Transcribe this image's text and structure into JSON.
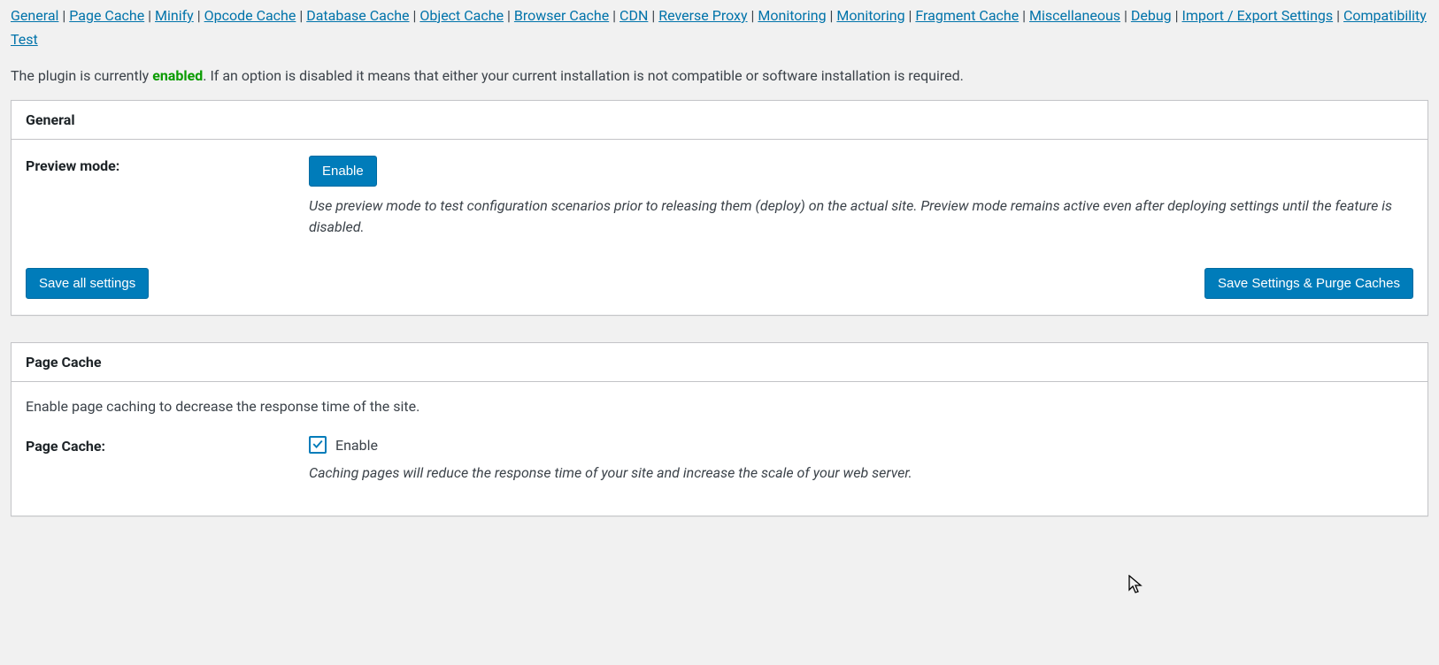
{
  "nav": {
    "items": [
      "General",
      "Page Cache",
      "Minify",
      "Opcode Cache",
      "Database Cache",
      "Object Cache",
      "Browser Cache",
      "CDN",
      "Reverse Proxy",
      "Monitoring",
      "Monitoring",
      "Fragment Cache",
      "Miscellaneous",
      "Debug",
      "Import / Export Settings",
      "Compatibility Test"
    ]
  },
  "status": {
    "prefix": "The plugin is currently ",
    "state": "enabled",
    "suffix": ". If an option is disabled it means that either your current installation is not compatible or software installation is required."
  },
  "general_box": {
    "title": "General",
    "preview_label": "Preview mode:",
    "enable_button": "Enable",
    "preview_desc": "Use preview mode to test configuration scenarios prior to releasing them (deploy) on the actual site. Preview mode remains active even after deploying settings until the feature is disabled.",
    "save_all": "Save all settings",
    "save_purge": "Save Settings & Purge Caches"
  },
  "page_cache_box": {
    "title": "Page Cache",
    "section_desc": "Enable page caching to decrease the response time of the site.",
    "label": "Page Cache:",
    "checkbox_label": "Enable",
    "checked": true,
    "desc": "Caching pages will reduce the response time of your site and increase the scale of your web server."
  }
}
